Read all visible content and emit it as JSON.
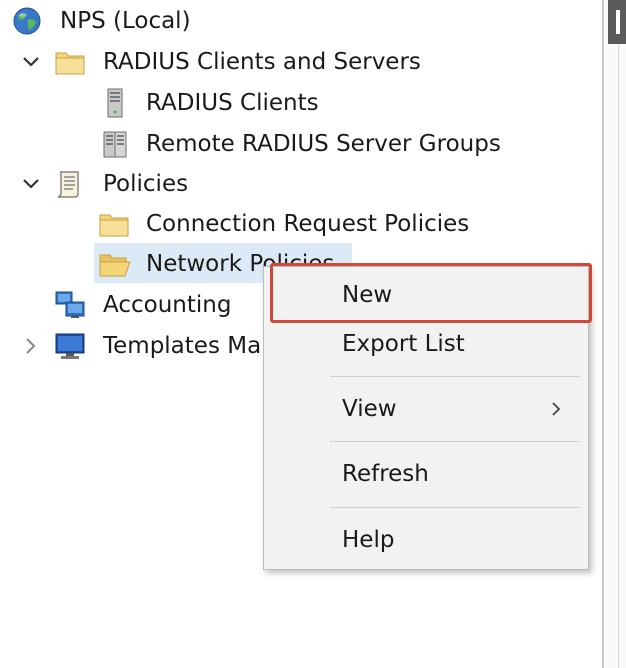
{
  "tree": {
    "root": {
      "label": "NPS (Local)",
      "icon": "globe-icon"
    },
    "items": [
      {
        "label": "RADIUS Clients and Servers",
        "icon": "folder-icon",
        "expanded": true
      },
      {
        "label": "RADIUS Clients",
        "icon": "server-icon"
      },
      {
        "label": "Remote RADIUS Server Groups",
        "icon": "server-group-icon"
      },
      {
        "label": "Policies",
        "icon": "policies-icon",
        "expanded": true
      },
      {
        "label": "Connection Request Policies",
        "icon": "folder-icon"
      },
      {
        "label": "Network Policies",
        "icon": "open-folder-icon",
        "selected": true
      },
      {
        "label": "Accounting",
        "icon": "accounting-icon"
      },
      {
        "label": "Templates Management",
        "icon": "monitor-icon",
        "expanded": false
      }
    ]
  },
  "context_menu": {
    "items": [
      {
        "label": "New",
        "highlighted": true
      },
      {
        "label": "Export List"
      },
      {
        "label": "View",
        "submenu": true
      },
      {
        "label": "Refresh"
      },
      {
        "label": "Help"
      }
    ],
    "highlight_color": "#d0483a"
  },
  "colors": {
    "selection": "#dce9f7",
    "menu_background": "#f2f2f2",
    "folder": "#f3d67a"
  }
}
